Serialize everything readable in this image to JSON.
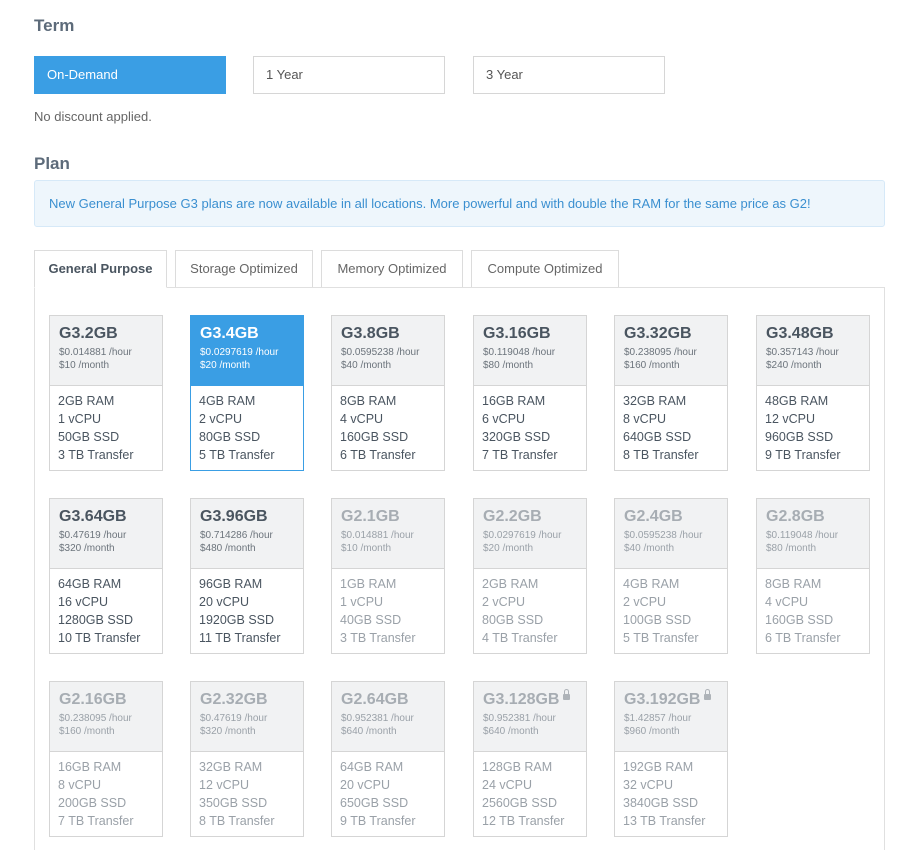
{
  "term": {
    "title": "Term",
    "options": [
      "On-Demand",
      "1 Year",
      "3 Year"
    ],
    "selected": "On-Demand",
    "discount_note": "No discount applied."
  },
  "plan": {
    "title": "Plan",
    "notice": "New General Purpose G3 plans are now available in all locations. More powerful and with double the RAM for the same price as G2!",
    "tabs": [
      "General Purpose",
      "Storage Optimized",
      "Memory Optimized",
      "Compute Optimized"
    ],
    "active_tab": "General Purpose",
    "selected_plan": "G3.4GB",
    "cards": [
      {
        "name": "G3.2GB",
        "hourly": "$0.014881 /hour",
        "monthly": "$10 /month",
        "ram": "2GB RAM",
        "cpu": "1 vCPU",
        "disk": "50GB SSD",
        "transfer": "3 TB Transfer"
      },
      {
        "name": "G3.4GB",
        "hourly": "$0.0297619 /hour",
        "monthly": "$20 /month",
        "ram": "4GB RAM",
        "cpu": "2 vCPU",
        "disk": "80GB SSD",
        "transfer": "5 TB Transfer"
      },
      {
        "name": "G3.8GB",
        "hourly": "$0.0595238 /hour",
        "monthly": "$40 /month",
        "ram": "8GB RAM",
        "cpu": "4 vCPU",
        "disk": "160GB SSD",
        "transfer": "6 TB Transfer"
      },
      {
        "name": "G3.16GB",
        "hourly": "$0.119048 /hour",
        "monthly": "$80 /month",
        "ram": "16GB RAM",
        "cpu": "6 vCPU",
        "disk": "320GB SSD",
        "transfer": "7 TB Transfer"
      },
      {
        "name": "G3.32GB",
        "hourly": "$0.238095 /hour",
        "monthly": "$160 /month",
        "ram": "32GB RAM",
        "cpu": "8 vCPU",
        "disk": "640GB SSD",
        "transfer": "8 TB Transfer"
      },
      {
        "name": "G3.48GB",
        "hourly": "$0.357143 /hour",
        "monthly": "$240 /month",
        "ram": "48GB RAM",
        "cpu": "12 vCPU",
        "disk": "960GB SSD",
        "transfer": "9 TB Transfer"
      },
      {
        "name": "G3.64GB",
        "hourly": "$0.47619 /hour",
        "monthly": "$320 /month",
        "ram": "64GB RAM",
        "cpu": "16 vCPU",
        "disk": "1280GB SSD",
        "transfer": "10 TB Transfer"
      },
      {
        "name": "G3.96GB",
        "hourly": "$0.714286 /hour",
        "monthly": "$480 /month",
        "ram": "96GB RAM",
        "cpu": "20 vCPU",
        "disk": "1920GB SSD",
        "transfer": "11 TB Transfer"
      },
      {
        "name": "G2.1GB",
        "hourly": "$0.014881 /hour",
        "monthly": "$10 /month",
        "ram": "1GB RAM",
        "cpu": "1 vCPU",
        "disk": "40GB SSD",
        "transfer": "3 TB Transfer"
      },
      {
        "name": "G2.2GB",
        "hourly": "$0.0297619 /hour",
        "monthly": "$20 /month",
        "ram": "2GB RAM",
        "cpu": "2 vCPU",
        "disk": "80GB SSD",
        "transfer": "4 TB Transfer"
      },
      {
        "name": "G2.4GB",
        "hourly": "$0.0595238 /hour",
        "monthly": "$40 /month",
        "ram": "4GB RAM",
        "cpu": "2 vCPU",
        "disk": "100GB SSD",
        "transfer": "5 TB Transfer"
      },
      {
        "name": "G2.8GB",
        "hourly": "$0.119048 /hour",
        "monthly": "$80 /month",
        "ram": "8GB RAM",
        "cpu": "4 vCPU",
        "disk": "160GB SSD",
        "transfer": "6 TB Transfer"
      },
      {
        "name": "G2.16GB",
        "hourly": "$0.238095 /hour",
        "monthly": "$160 /month",
        "ram": "16GB RAM",
        "cpu": "8 vCPU",
        "disk": "200GB SSD",
        "transfer": "7 TB Transfer"
      },
      {
        "name": "G2.32GB",
        "hourly": "$0.47619 /hour",
        "monthly": "$320 /month",
        "ram": "32GB RAM",
        "cpu": "12 vCPU",
        "disk": "350GB SSD",
        "transfer": "8 TB Transfer"
      },
      {
        "name": "G2.64GB",
        "hourly": "$0.952381 /hour",
        "monthly": "$640 /month",
        "ram": "64GB RAM",
        "cpu": "20 vCPU",
        "disk": "650GB SSD",
        "transfer": "9 TB Transfer"
      },
      {
        "name": "G3.128GB",
        "hourly": "$0.952381 /hour",
        "monthly": "$640 /month",
        "ram": "128GB RAM",
        "cpu": "24 vCPU",
        "disk": "2560GB SSD",
        "transfer": "12 TB Transfer",
        "icon": "lock-icon"
      },
      {
        "name": "G3.192GB",
        "hourly": "$1.42857 /hour",
        "monthly": "$960 /month",
        "ram": "192GB RAM",
        "cpu": "32 vCPU",
        "disk": "3840GB SSD",
        "transfer": "13 TB Transfer",
        "icon": "lock-icon"
      }
    ],
    "colors": {
      "accent": "#3a9ee4",
      "notice_bg": "#eef6fc",
      "notice_text": "#3a8fd0"
    }
  }
}
